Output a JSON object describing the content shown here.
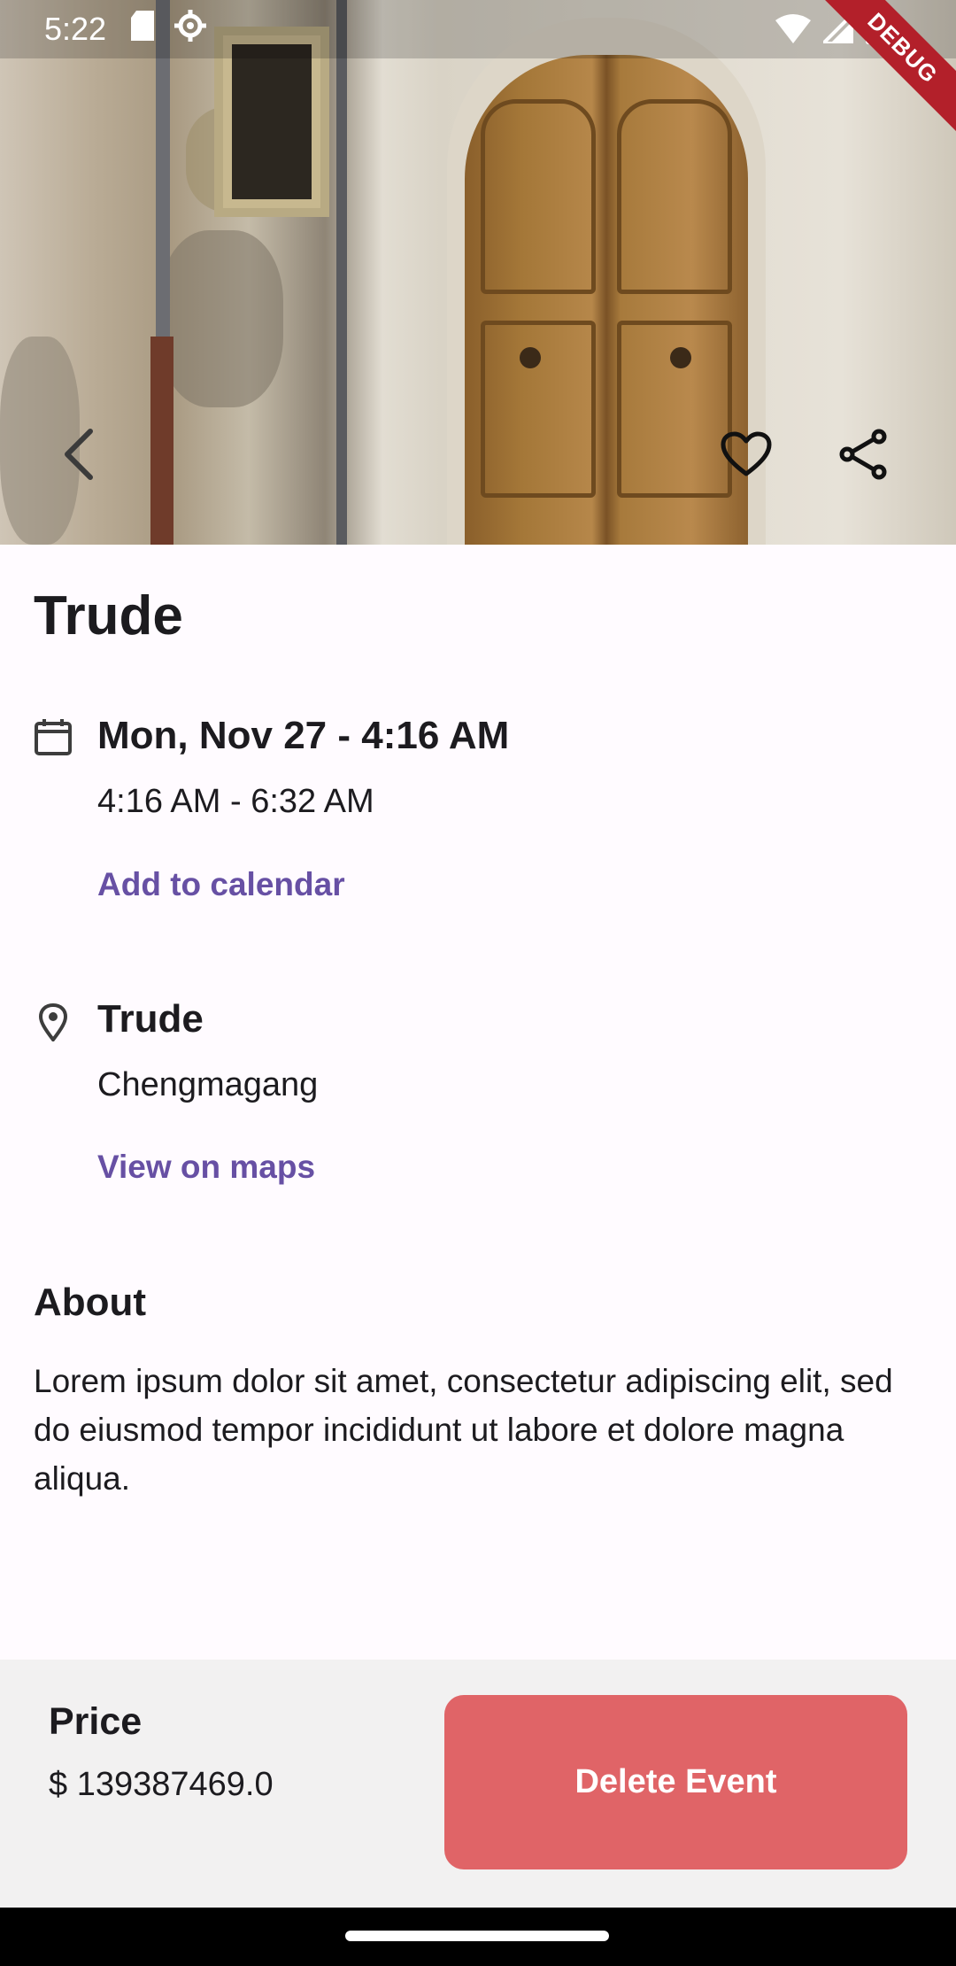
{
  "status_bar": {
    "time": "5:22",
    "debug_label": "DEBUG"
  },
  "hero": {
    "back_icon": "chevron-left-icon",
    "favorite_icon": "heart-outline-icon",
    "share_icon": "share-icon"
  },
  "event": {
    "title": "Trude",
    "date_heading": "Mon, Nov 27 - 4:16 AM",
    "time_range": "4:16 AM - 6:32 AM",
    "add_calendar_label": "Add to calendar",
    "venue_name": "Trude",
    "venue_city": "Chengmagang",
    "view_maps_label": "View on maps",
    "about_heading": "About",
    "about_text": "Lorem ipsum dolor sit amet, consectetur adipiscing elit, sed do eiusmod tempor incididunt ut labore et dolore magna aliqua."
  },
  "footer": {
    "price_label": "Price",
    "price_value": "$ 139387469.0",
    "delete_label": "Delete Event"
  },
  "colors": {
    "accent": "#6750a4",
    "delete": "#e06467",
    "background": "#fffbff",
    "bottom_bar": "#f2f1f1"
  }
}
